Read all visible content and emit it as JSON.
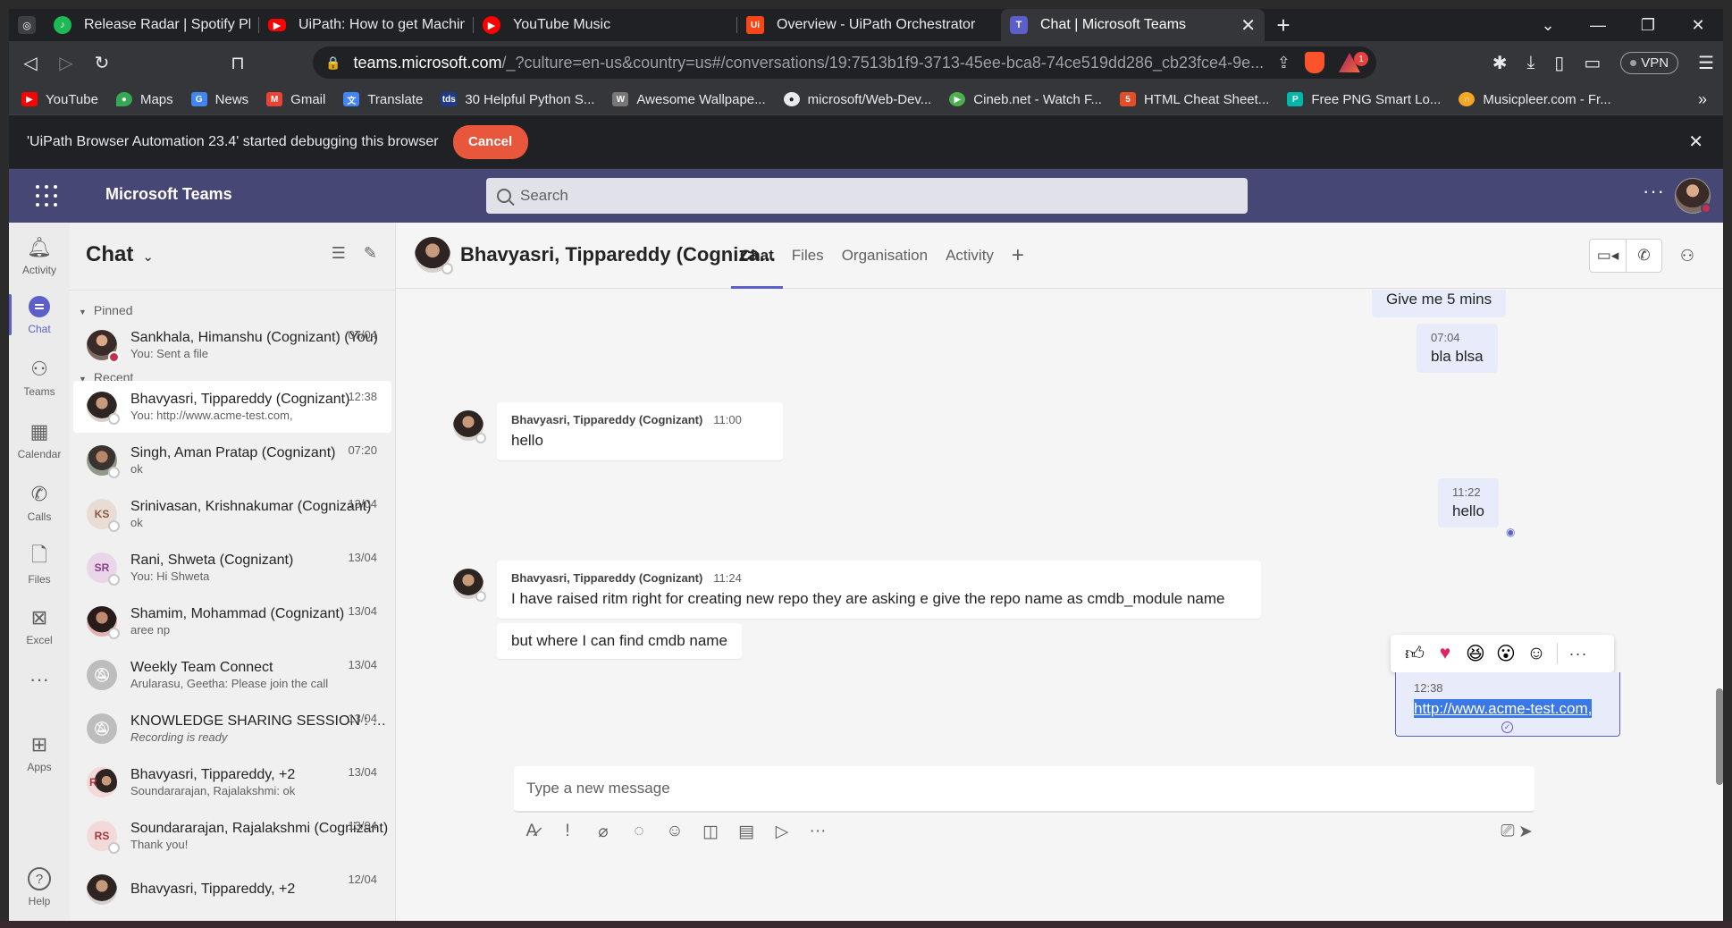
{
  "browser": {
    "tabs": [
      {
        "title": "Release Radar | Spotify Playlist",
        "icon": "spotify-icon",
        "color": "#1db954"
      },
      {
        "title": "UiPath: How to get Machine Key - You",
        "icon": "youtube-icon",
        "color": "#ff0000"
      },
      {
        "title": "YouTube Music",
        "icon": "youtube-music-icon",
        "color": "#ff0000"
      },
      {
        "title": "Overview - UiPath Orchestrator",
        "icon": "uipath-icon",
        "color": "#fa4616"
      },
      {
        "title": "Chat | Microsoft Teams",
        "icon": "teams-icon",
        "color": "#5b5fc7",
        "active": true
      }
    ],
    "url": {
      "host": "teams.microsoft.com",
      "path": "/_?culture=en-us&country=us#/conversations/19:7513b1f9-3713-45ee-bca8-74ce519dd286_cb23fce4-9e..."
    },
    "rewards_badge": "1",
    "vpn_label": "VPN",
    "bookmarks": [
      {
        "label": "YouTube",
        "icon": "youtube-icon"
      },
      {
        "label": "Maps",
        "icon": "maps-icon"
      },
      {
        "label": "News",
        "icon": "news-icon"
      },
      {
        "label": "Gmail",
        "icon": "gmail-icon"
      },
      {
        "label": "Translate",
        "icon": "translate-icon"
      },
      {
        "label": "30 Helpful Python S...",
        "icon": "tds-icon"
      },
      {
        "label": "Awesome Wallpape...",
        "icon": "wallpaper-icon"
      },
      {
        "label": "microsoft/Web-Dev...",
        "icon": "github-icon"
      },
      {
        "label": "Cineb.net - Watch F...",
        "icon": "cineb-icon"
      },
      {
        "label": "HTML Cheat Sheet...",
        "icon": "html-icon"
      },
      {
        "label": "Free PNG Smart Lo...",
        "icon": "png-icon"
      },
      {
        "label": "Musicpleer.com - Fr...",
        "icon": "music-icon"
      }
    ],
    "debug_message": "'UiPath Browser Automation 23.4' started debugging this browser",
    "cancel_label": "Cancel"
  },
  "teams": {
    "app_title": "Microsoft Teams",
    "search_placeholder": "Search",
    "rail": [
      {
        "label": "Activity",
        "icon": "bell-icon"
      },
      {
        "label": "Chat",
        "icon": "chat-icon",
        "active": true
      },
      {
        "label": "Teams",
        "icon": "teams-group-icon"
      },
      {
        "label": "Calendar",
        "icon": "calendar-icon"
      },
      {
        "label": "Calls",
        "icon": "phone-icon"
      },
      {
        "label": "Files",
        "icon": "file-icon"
      },
      {
        "label": "Excel",
        "icon": "excel-icon"
      },
      {
        "label": "",
        "icon": "more-apps-icon"
      },
      {
        "label": "Apps",
        "icon": "apps-icon"
      },
      {
        "label": "Help",
        "icon": "help-icon"
      }
    ],
    "chat_list": {
      "title": "Chat",
      "pinned_label": "Pinned",
      "recent_label": "Recent",
      "pinned": [
        {
          "name": "Sankhala, Himanshu (Cognizant) (You)",
          "preview": "You: Sent a file",
          "time": "07/04"
        }
      ],
      "recent": [
        {
          "name": "Bhavyasri, Tippareddy (Cognizant)",
          "preview": "You: http://www.acme-test.com,",
          "time": "12:38",
          "initials": ""
        },
        {
          "name": "Singh, Aman Pratap (Cognizant)",
          "preview": "ok",
          "time": "07:20",
          "initials": ""
        },
        {
          "name": "Srinivasan, Krishnakumar (Cognizant)",
          "preview": "ok",
          "time": "13/04",
          "initials": "KS"
        },
        {
          "name": "Rani, Shweta (Cognizant)",
          "preview": "You: Hi Shweta",
          "time": "13/04",
          "initials": "SR"
        },
        {
          "name": "Shamim, Mohammad (Cognizant)",
          "preview": "aree np",
          "time": "13/04",
          "initials": ""
        },
        {
          "name": "Weekly Team Connect",
          "preview": "Arularasu, Geetha: Please join the call",
          "time": "13/04",
          "initials": ""
        },
        {
          "name": "KNOWLEDGE SHARING SESSION : Exc...",
          "preview": "Recording is ready",
          "time": "13/04",
          "initials": ""
        },
        {
          "name": "Bhavyasri, Tippareddy, +2",
          "preview": "Soundararajan, Rajalakshmi: ok",
          "time": "13/04",
          "initials": "R"
        },
        {
          "name": "Soundararajan, Rajalakshmi (Cognizant)",
          "preview": "Thank you!",
          "time": "13/04",
          "initials": "RS"
        },
        {
          "name": "Bhavyasri, Tippareddy, +2",
          "preview": "",
          "time": "12/04",
          "initials": ""
        }
      ]
    },
    "conversation": {
      "title": "Bhavyasri, Tippareddy (Cogniza...",
      "tabs": [
        "Chat",
        "Files",
        "Organisation",
        "Activity"
      ],
      "messages": {
        "m1_text": "Give me 5 mins",
        "m2_time": "07:04",
        "m2_text": "bla blsa",
        "m3_sender": "Bhavyasri, Tippareddy (Cognizant)",
        "m3_time": "11:00",
        "m3_text": "hello",
        "m4_time": "11:22",
        "m4_text": "hello",
        "m5_sender": "Bhavyasri, Tippareddy (Cognizant)",
        "m5_time": "11:24",
        "m5_text": "I have raised ritm right for creating new repo they are asking e give the repo name as cmdb_module name",
        "m6_text": "but where I can find cmdb name",
        "m7_time": "12:38",
        "m7_text": "http://www.acme-test.com,"
      },
      "compose_placeholder": "Type a new message"
    }
  }
}
